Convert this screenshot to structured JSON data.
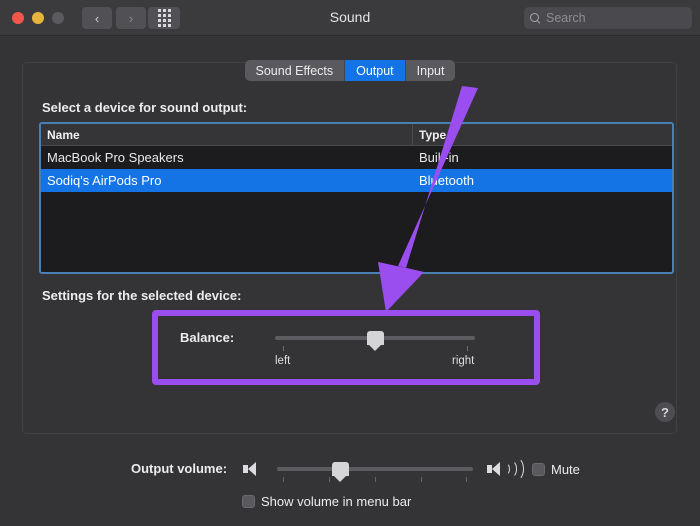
{
  "window": {
    "title": "Sound",
    "traffic_lights": [
      "close",
      "minimize",
      "zoom-disabled"
    ],
    "nav": {
      "back": "‹",
      "forward": "›"
    },
    "grid_button": "show-all-icon"
  },
  "search": {
    "placeholder": "Search",
    "icon": "search-icon"
  },
  "tabs": [
    {
      "label": "Sound Effects",
      "active": false
    },
    {
      "label": "Output",
      "active": true
    },
    {
      "label": "Input",
      "active": false
    }
  ],
  "output_pane": {
    "select_label": "Select a device for sound output:",
    "table": {
      "columns": [
        "Name",
        "Type"
      ],
      "rows": [
        {
          "name": "MacBook Pro Speakers",
          "type": "Built-in",
          "selected": false
        },
        {
          "name": "Sodiq's AirPods Pro",
          "type": "Bluetooth",
          "selected": true
        }
      ]
    },
    "settings_label": "Settings for the selected device:",
    "balance": {
      "label": "Balance:",
      "left_label": "left",
      "right_label": "right",
      "value_percent": 50
    },
    "help_button": "?"
  },
  "footer": {
    "output_volume_label": "Output volume:",
    "volume_percent": 32,
    "mute_label": "Mute",
    "mute_checked": false,
    "show_volume_label": "Show volume in menu bar",
    "show_volume_checked": false,
    "speaker_low_icon": "speaker-icon",
    "speaker_high_icon": "speaker-waves-icon"
  },
  "annotation": {
    "arrow_color": "#9b4ef0",
    "highlight_color": "#9b4ef0"
  }
}
